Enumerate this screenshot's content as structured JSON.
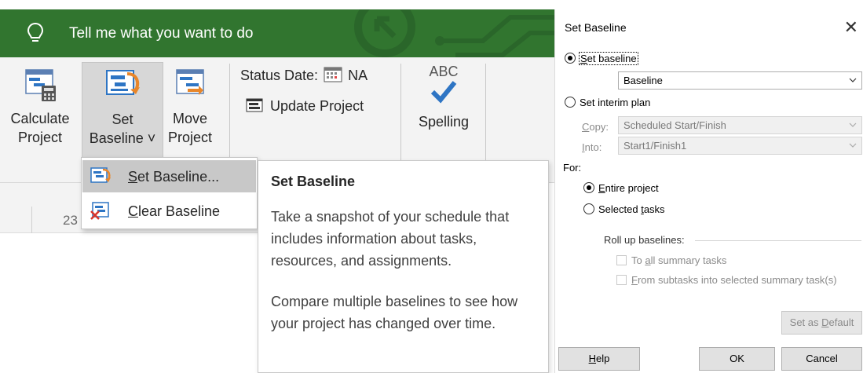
{
  "tellbar": {
    "text": "Tell me what you want to do"
  },
  "ribbon": {
    "calculate": {
      "line1": "Calculate",
      "line2": "Project"
    },
    "set_baseline": {
      "line1": "Set",
      "line2": "Baseline ˅"
    },
    "move": {
      "line1": "Move",
      "line2": "Project"
    },
    "status_date_label": "Status Date:",
    "status_date_value": "NA",
    "update_project": "Update Project",
    "spelling_abc": "ABC",
    "spelling_label": "Spelling",
    "ruler_number": "23"
  },
  "dropdown": {
    "items": [
      {
        "label_underlined": "S",
        "label_rest": "et Baseline...",
        "icon": "set-baseline-icon"
      },
      {
        "label_underlined": "C",
        "label_rest": "lear Baseline",
        "icon": "clear-baseline-icon"
      }
    ]
  },
  "tooltip": {
    "title": "Set Baseline",
    "paragraph1": "Take a snapshot of your schedule that includes information about tasks, resources, and assignments.",
    "paragraph2": "Compare multiple baselines to see how your project has changed over time."
  },
  "dialog": {
    "title": "Set Baseline",
    "set_baseline_radio": {
      "u": "S",
      "rest": "et baseline"
    },
    "baseline_combo": "Baseline",
    "set_interim_plan": "Set interim plan",
    "copy_label": {
      "u": "C",
      "rest": "opy:"
    },
    "copy_value": "Scheduled Start/Finish",
    "into_label": {
      "u": "I",
      "rest": "nto:"
    },
    "into_value": "Start1/Finish1",
    "for_label": "For:",
    "entire_project": {
      "u": "E",
      "rest": "ntire project"
    },
    "selected_tasks": {
      "pre": "Selected ",
      "u": "t",
      "rest": "asks"
    },
    "roll_up_label": "Roll up baselines:",
    "to_all_summary": {
      "pre": "To ",
      "u": "a",
      "rest": "ll summary tasks"
    },
    "from_subtasks": {
      "u": "F",
      "rest": "rom subtasks into selected summary task(s)"
    },
    "set_as_default": {
      "pre": "Set as ",
      "u": "D",
      "rest": "efault"
    },
    "help": {
      "u": "H",
      "rest": "elp"
    },
    "ok": "OK",
    "cancel": "Cancel"
  },
  "colors": {
    "tellbar_green": "#31752f",
    "accent_blue": "#1e6bc5",
    "accent_orange": "#e8862a"
  }
}
